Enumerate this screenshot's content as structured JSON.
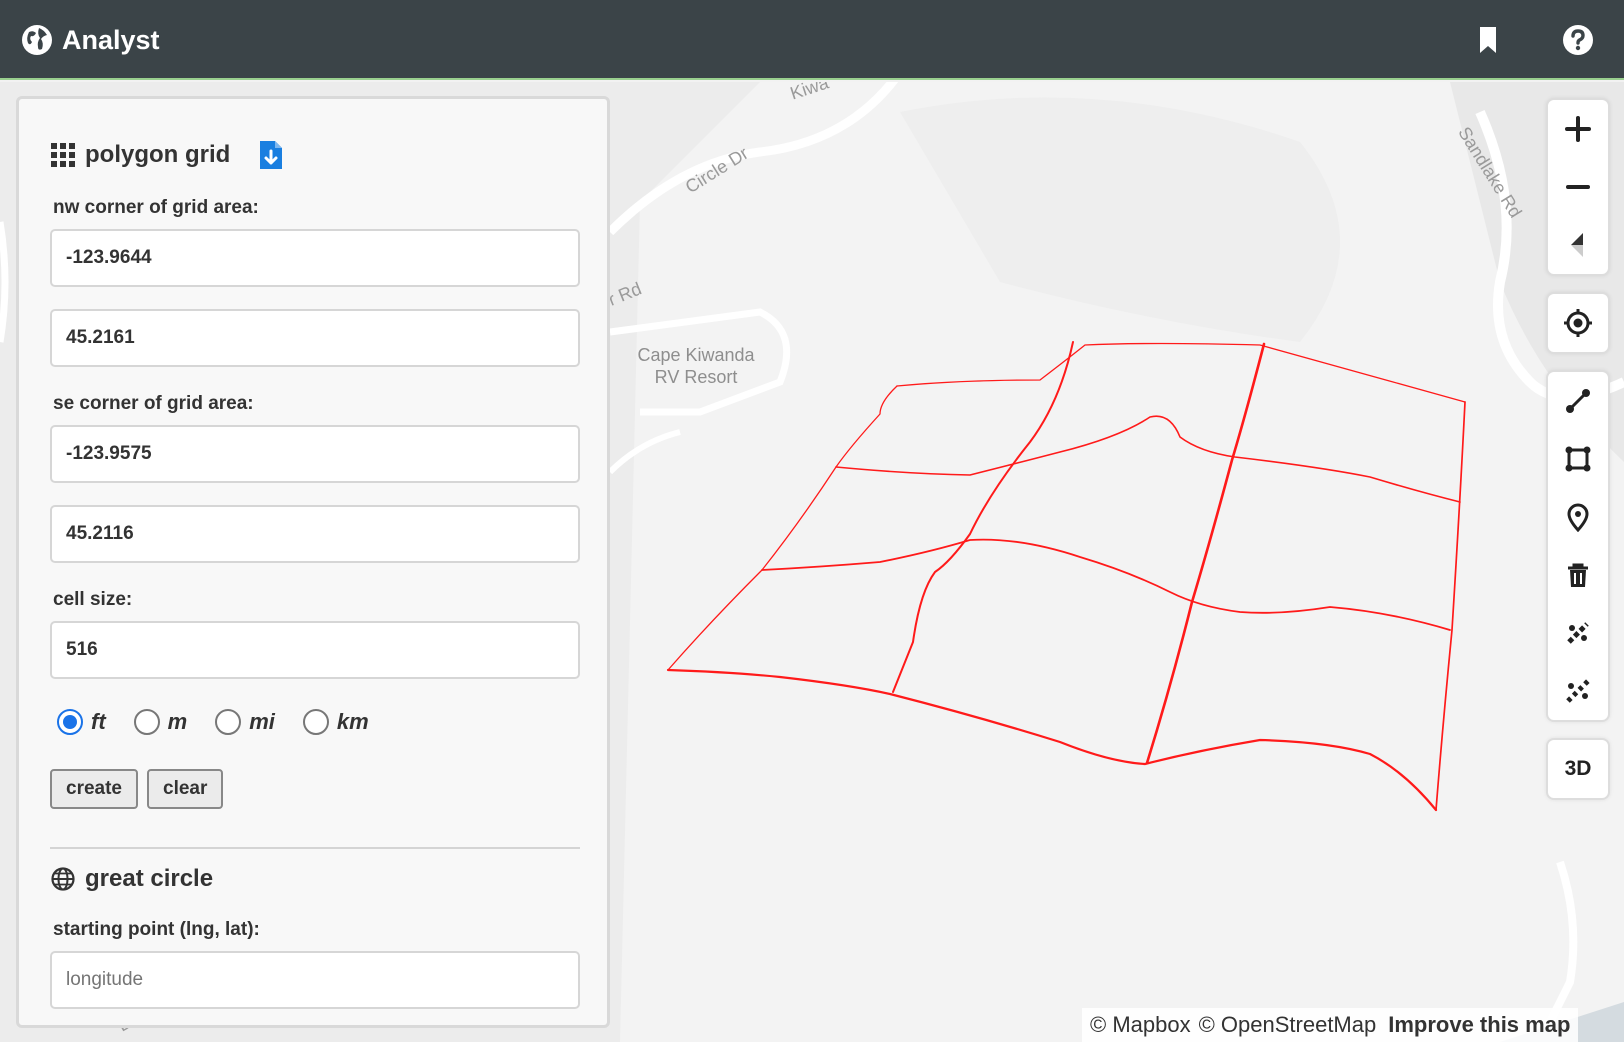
{
  "app": {
    "title": "Analyst"
  },
  "topbar": {
    "bookmark_icon": "bookmark-icon",
    "help_icon": "question-circle-icon"
  },
  "map": {
    "labels": [
      "Circle Dr",
      "Sandlake Rd",
      "Kiwa",
      "r Rd",
      "Dr"
    ],
    "poi": {
      "line1": "Cape Kiwanda",
      "line2": "RV Resort"
    },
    "grid_color": "#ff0000",
    "attribution": {
      "mapbox": "© Mapbox",
      "osm": "© OpenStreetMap",
      "improve": "Improve this map"
    }
  },
  "panel": {
    "polygon_grid": {
      "title": "polygon grid",
      "icon": "grid-icon",
      "download_icon": "file-download-icon",
      "nw_label": "nw corner of grid area:",
      "nw_lng": "-123.9644",
      "nw_lat": "45.2161",
      "se_label": "se corner of grid area:",
      "se_lng": "-123.9575",
      "se_lat": "45.2116",
      "cell_size_label": "cell size:",
      "cell_size": "516",
      "units": [
        "ft",
        "m",
        "mi",
        "km"
      ],
      "selected_unit": "ft",
      "create_label": "create",
      "clear_label": "clear"
    },
    "great_circle": {
      "title": "great circle",
      "icon": "globe-icon",
      "start_label": "starting point (lng, lat):",
      "lng_placeholder": "longitude"
    }
  },
  "controls": {
    "zoom_in": "plus-icon",
    "zoom_out": "minus-icon",
    "compass": "compass-icon",
    "geolocate": "crosshair-icon",
    "draw_line": "line-draw-icon",
    "draw_polygon": "polygon-draw-icon",
    "draw_point": "marker-icon",
    "trash": "trash-icon",
    "combine": "combine-icon",
    "uncombine": "uncombine-icon",
    "three_d_label": "3D"
  },
  "accent_color": "#1a73e8"
}
